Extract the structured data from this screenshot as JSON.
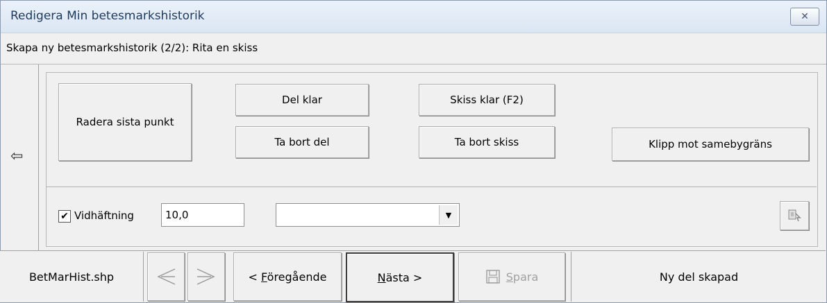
{
  "window": {
    "title": "Redigera Min betesmarkshistorik",
    "close_icon": "close-x-icon"
  },
  "step": {
    "label": "Skapa ny betesmarkshistorik (2/2): Rita en skiss"
  },
  "tools": {
    "radera_sista_punkt": "Radera sista punkt",
    "del_klar": "Del klar",
    "ta_bort_del": "Ta bort del",
    "skiss_klar": "Skiss klar (F2)",
    "ta_bort_skiss": "Ta bort skiss",
    "klipp_mot_samebygrans": "Klipp mot samebygräns",
    "vidhaftning_label": "Vidhäftning",
    "vidhaftning_checked": true,
    "vidhaftning_value": "10,0",
    "combo_value": ""
  },
  "bottom": {
    "layer_name": "BetMarHist.shp",
    "prev_label_prefix": "< ",
    "prev_label_u": "F",
    "prev_label_rest": "öregående",
    "next_label_u": "N",
    "next_label_rest": "ästa >",
    "save_label_u": "S",
    "save_label_rest": "para",
    "status": "Ny del skapad"
  }
}
